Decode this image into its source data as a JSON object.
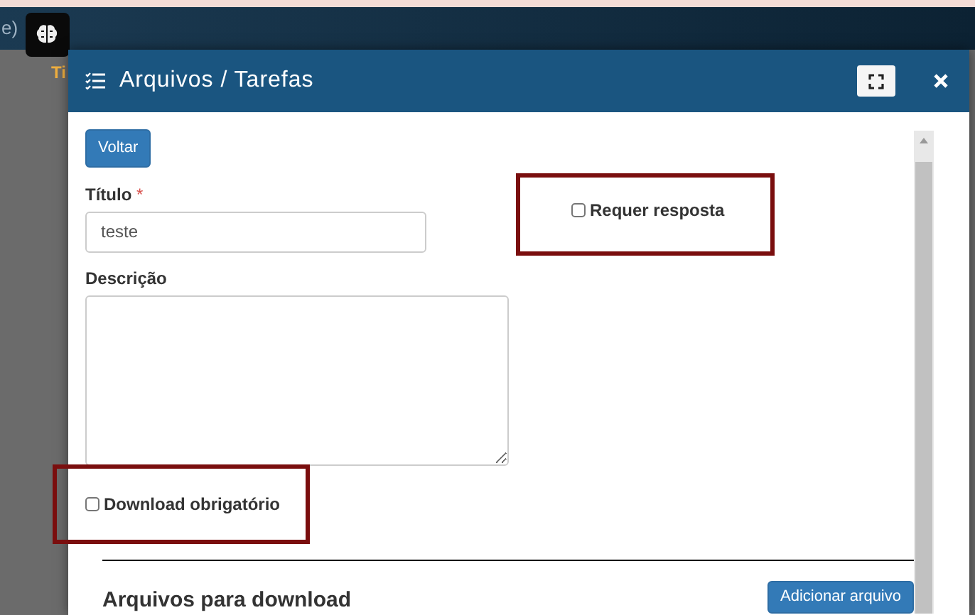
{
  "background": {
    "top_fragment": "e)",
    "column_fragment": "Ti"
  },
  "modal": {
    "title": "Arquivos / Tarefas",
    "back_button": "Voltar",
    "fields": [
      {
        "label": "Título",
        "required_mark": "*",
        "value": "teste"
      },
      {
        "label": "Descrição"
      }
    ],
    "checkboxes": [
      {
        "label": "Requer resposta",
        "checked": false,
        "highlighted": true
      },
      {
        "label": "Download obrigatório",
        "checked": false,
        "highlighted": true
      }
    ],
    "section_title": "Arquivos para download",
    "add_button": "Adicionar arquivo"
  }
}
